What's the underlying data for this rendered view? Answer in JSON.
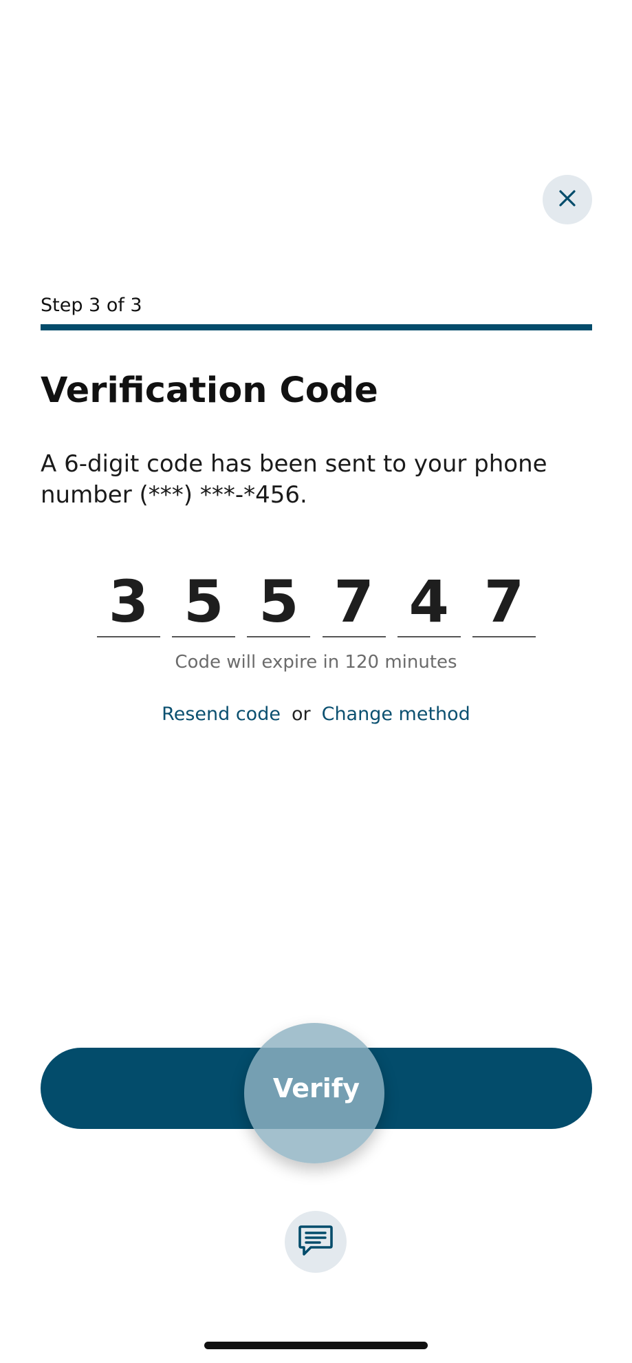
{
  "header": {
    "close_icon": "close-icon"
  },
  "progress": {
    "step_label": "Step 3 of 3",
    "fraction": 1.0,
    "color": "#034c6b"
  },
  "main": {
    "title": "Verification Code",
    "description": "A 6-digit code has been sent to your phone number (***) ***-*456.",
    "code_digits": [
      "3",
      "5",
      "5",
      "7",
      "4",
      "7"
    ],
    "expire_text": "Code will expire in 120 minutes",
    "resend_label": "Resend code",
    "or_label": "or",
    "change_method_label": "Change method"
  },
  "actions": {
    "verify_label": "Verify",
    "chat_icon": "chat-icon"
  },
  "colors": {
    "primary": "#034c6b",
    "link": "#0b5070",
    "icon_bg": "#e3e9ee"
  }
}
